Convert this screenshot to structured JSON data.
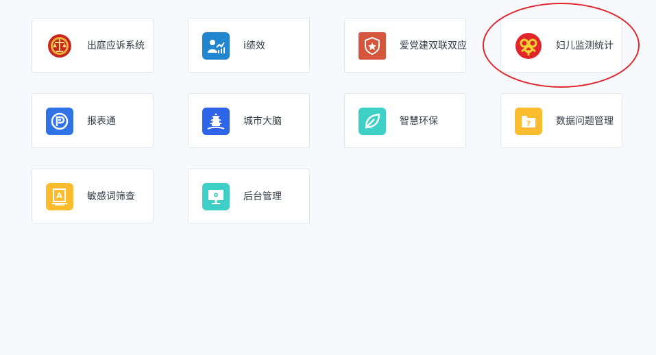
{
  "apps": [
    {
      "label": "出庭应诉系统",
      "icon": "court-emblem-icon",
      "color": "#c8271f"
    },
    {
      "label": "i绩效",
      "icon": "performance-chart-icon",
      "color": "#2185d0"
    },
    {
      "label": "爱党建双联双应",
      "icon": "party-shield-star-icon",
      "color": "#d4573d"
    },
    {
      "label": "妇儿监测统计",
      "icon": "women-federation-emblem-icon",
      "color": "#e0262b"
    },
    {
      "label": "报表通",
      "icon": "report-p-icon",
      "color": "#2f73e6"
    },
    {
      "label": "城市大脑",
      "icon": "city-pagoda-icon",
      "color": "#2d64e8"
    },
    {
      "label": "智慧环保",
      "icon": "leaf-icon",
      "color": "#3ed0c6"
    },
    {
      "label": "数据问题管理",
      "icon": "question-folder-icon",
      "color": "#fbbd2e"
    },
    {
      "label": "敏感词筛查",
      "icon": "document-a-icon",
      "color": "#fbbd2e"
    },
    {
      "label": "后台管理",
      "icon": "monitor-gear-icon",
      "color": "#3ed0c6"
    }
  ]
}
